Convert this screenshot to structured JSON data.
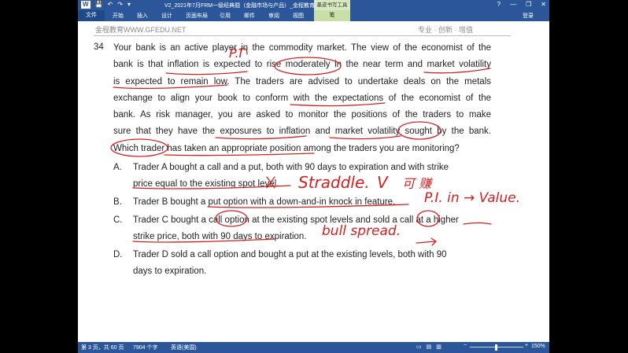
{
  "window": {
    "title": "V2_2021年7月FRM一级经典题（金融市场与产品）_金程教育Y...",
    "context_tab_title": "墨迹书写工具",
    "help": "?",
    "minimize": "—",
    "restore": "❐",
    "close": "✕"
  },
  "qat": {
    "save": "💾",
    "undo": "↶",
    "redo": "↷",
    "more": "▾"
  },
  "ribbon": {
    "file_tab": "文件",
    "tabs": [
      "开始",
      "插入",
      "设计",
      "页面布局",
      "引用",
      "邮件",
      "审阅",
      "视图"
    ],
    "context_tab": "笔",
    "login": "登录"
  },
  "page_header": {
    "left": "金程教育WWW.GFEDU.NET",
    "right": "专业 · 创新 · 增值"
  },
  "question": {
    "number": "34",
    "lines": [
      "Your bank is an active player in the commodity market. The view of the economist of the",
      "bank is that inflation is expected to rise moderately in the near term and market volatility",
      "is expected to remain low. The traders are advised to undertake deals on the metals",
      "exchange to align your book to conform with the expectations of the economist of the",
      "bank. As risk manager, you are asked to monitor the positions of the traders to make",
      "sure that they have the exposures to inflation and market volatility sought by the bank.",
      "Which trader has taken an appropriate position among the traders you are monitoring?"
    ]
  },
  "options": [
    {
      "letter": "A.",
      "lines": [
        "Trader A bought a call and a put, both with 90 days to expiration and with strike",
        "price equal to the existing spot level."
      ]
    },
    {
      "letter": "B.",
      "lines": [
        "Trader B bought a put option with a down-and-in knock in feature."
      ]
    },
    {
      "letter": "C.",
      "lines": [
        "Trader C bought a call option at the existing spot levels and sold a call at a higher",
        "strike price, both with 90 days to expiration."
      ]
    },
    {
      "letter": "D.",
      "lines": [
        "Trader D sold a call option and bought a put at the existing levels, both with 90",
        "days to expiration."
      ]
    }
  ],
  "annotations": {
    "straddle": "Straddle.",
    "v_note": "V",
    "cn_note": "可 赚",
    "p_note": "P.I",
    "pi_value": "P.I. in → Value.",
    "bull_spread": "bull spread."
  },
  "statusbar": {
    "page_info": "第 3 页，共 60 页",
    "word_count": "7904 个字",
    "language": "英语(美国)",
    "zoom_minus": "−",
    "zoom_plus": "+",
    "zoom_level": "150%"
  },
  "colors": {
    "ink": "#d42020",
    "ribbon": "#2b579a",
    "context_tab": "#c8e0a8"
  }
}
